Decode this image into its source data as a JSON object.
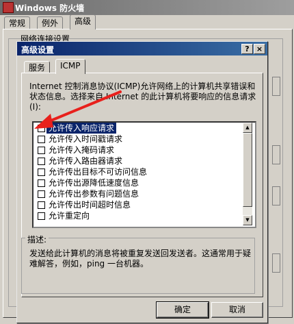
{
  "background_window": {
    "title": "Windows 防火墙",
    "tabs": [
      "常规",
      "例外",
      "高级"
    ],
    "active_tab": "高级",
    "group_label": "网络连接设置"
  },
  "dialog": {
    "title": "高级设置",
    "help_glyph": "?",
    "close_glyph": "×",
    "tabs": [
      "服务",
      "ICMP"
    ],
    "active_tab": "ICMP",
    "description": "Internet 控制消息协议(ICMP)允许网络上的计算机共享错误和状态信息。选择来自 Internet 的此计算机将要响应的信息请求(I):",
    "requests": [
      {
        "label": "允许传入响应请求",
        "checked": false,
        "selected": true
      },
      {
        "label": "允许传入时间戳请求",
        "checked": false,
        "selected": false
      },
      {
        "label": "允许传入掩码请求",
        "checked": false,
        "selected": false
      },
      {
        "label": "允许传入路由器请求",
        "checked": false,
        "selected": false
      },
      {
        "label": "允许传出目标不可访问信息",
        "checked": false,
        "selected": false
      },
      {
        "label": "允许传出源降低速度信息",
        "checked": false,
        "selected": false
      },
      {
        "label": "允许传出参数有问题信息",
        "checked": false,
        "selected": false
      },
      {
        "label": "允许传出时间超时信息",
        "checked": false,
        "selected": false
      },
      {
        "label": "允许重定向",
        "checked": false,
        "selected": false
      }
    ],
    "info_group_label": "描述:",
    "info_text": "发送给此计算机的消息将被重复发送回发送者。这通常用于疑难解答，例如，ping 一台机器。",
    "ok_label": "确定",
    "cancel_label": "取消"
  },
  "colors": {
    "titlebar_active": "#0a246a",
    "selection": "#0a246a",
    "annotation_arrow": "#e8201c",
    "face": "#d4d0c8"
  }
}
